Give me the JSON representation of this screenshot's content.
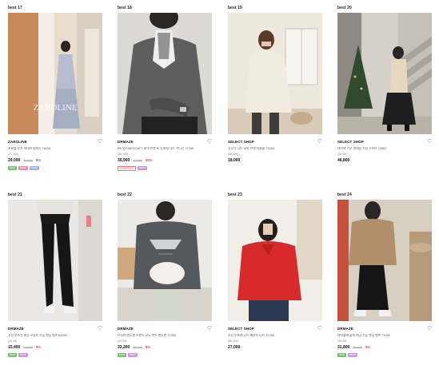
{
  "products": [
    {
      "rank": "best 17",
      "brand": "ZAROLINE",
      "name": "꼬뮤블 루즈 마네카 원피스 78226",
      "count": "(77 159)",
      "price": "29,000",
      "orig": "35,000",
      "disc": "8%",
      "badges": [
        {
          "label": "NEW",
          "color": "#7bbf7b"
        },
        {
          "label": "BEST",
          "color": "#e58fb5"
        },
        {
          "label": "SALE",
          "color": "#9ab5e0"
        }
      ],
      "watermark": "ZAROLINE",
      "heart": "♡"
    },
    {
      "rank": "best 18",
      "brand": "DRMAZE",
      "name": "[특가] FINECOATY 네넥 브랜 룩 투포레 니트 가디건 72786",
      "count": "(88 133)",
      "price": "35,900",
      "orig": "42,000",
      "disc": "20%",
      "badges": [
        {
          "label": "FLASHSALE",
          "color": "#ff6b6b",
          "outline": true
        },
        {
          "label": "BEST",
          "color": "#c89bd8"
        }
      ],
      "heart": "♡"
    },
    {
      "rank": "best 19",
      "brand": "SELECT SHOP",
      "name": "감후다 니트 오버 브랜 터클롭 73146",
      "count": "(88 128)",
      "price": "18,000",
      "orig": "",
      "disc": "",
      "badges": [],
      "heart": "♡"
    },
    {
      "rank": "best 20",
      "brand": "SELECT SHOP",
      "name": "데이에 가로 멀레움 주닝 스커트 72687",
      "count": "(35 39)",
      "price": "46,800",
      "orig": "",
      "disc": "",
      "badges": [],
      "heart": "♡"
    },
    {
      "rank": "best 21",
      "brand": "DRMAZE",
      "name": "루전 부츠컷 레깅 모델리 기능 밴딩 팬츠 62082",
      "count": "(30 38)",
      "price": "15,400",
      "orig": "19,000",
      "disc": "8%",
      "badges": [
        {
          "label": "NEW",
          "color": "#7bbf7b"
        },
        {
          "label": "BEST",
          "color": "#c89bd8"
        }
      ],
      "heart": "♡"
    },
    {
      "rank": "best 22",
      "brand": "DRMAZE",
      "name": "브루피 맨투맨 브랜드 모노 여우 맨투맨 72765",
      "count": "(30 35)",
      "price": "33,200",
      "orig": "38,000",
      "disc": "8%",
      "badges": [
        {
          "label": "NEW",
          "color": "#7bbf7b"
        },
        {
          "label": "BEST",
          "color": "#c89bd8"
        }
      ],
      "heart": "♡"
    },
    {
      "rank": "best 23",
      "brand": "SELECT SHOP",
      "name": "루전 투포레 니트 배부터 니트 72786",
      "count": "(88 120)",
      "price": "27,000",
      "orig": "",
      "disc": "",
      "badges": [],
      "heart": "♡"
    },
    {
      "rank": "best 24",
      "brand": "DRMAZE",
      "name": "데이블레 슬랙 레깅 기능 밴딩 팬츠 73036",
      "count": "(35 38)",
      "price": "31,800",
      "orig": "35,000",
      "disc": "8%",
      "badges": [
        {
          "label": "NEW",
          "color": "#7bbf7b"
        },
        {
          "label": "BEST",
          "color": "#c89bd8"
        }
      ],
      "heart": "♡"
    }
  ]
}
